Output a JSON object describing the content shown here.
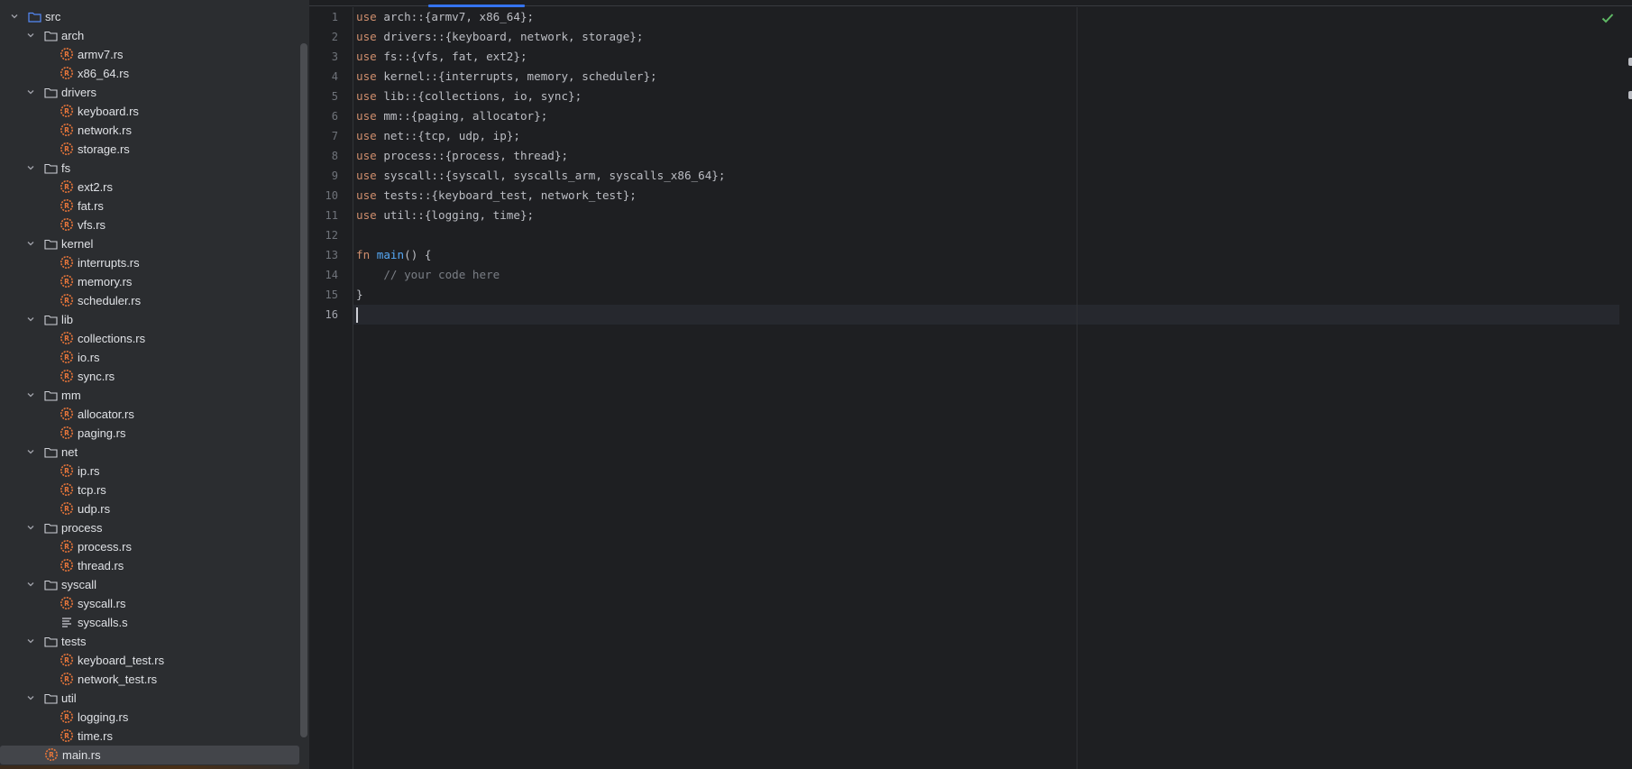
{
  "project_tree": {
    "items": [
      {
        "label": "src",
        "kind": "folder",
        "depth": 0,
        "expanded": true,
        "selected": false
      },
      {
        "label": "arch",
        "kind": "folder",
        "depth": 1,
        "expanded": true,
        "selected": false
      },
      {
        "label": "armv7.rs",
        "kind": "rust-file",
        "depth": 2,
        "selected": false
      },
      {
        "label": "x86_64.rs",
        "kind": "rust-file",
        "depth": 2,
        "selected": false
      },
      {
        "label": "drivers",
        "kind": "folder",
        "depth": 1,
        "expanded": true,
        "selected": false
      },
      {
        "label": "keyboard.rs",
        "kind": "rust-file",
        "depth": 2,
        "selected": false
      },
      {
        "label": "network.rs",
        "kind": "rust-file",
        "depth": 2,
        "selected": false
      },
      {
        "label": "storage.rs",
        "kind": "rust-file",
        "depth": 2,
        "selected": false
      },
      {
        "label": "fs",
        "kind": "folder",
        "depth": 1,
        "expanded": true,
        "selected": false
      },
      {
        "label": "ext2.rs",
        "kind": "rust-file",
        "depth": 2,
        "selected": false
      },
      {
        "label": "fat.rs",
        "kind": "rust-file",
        "depth": 2,
        "selected": false
      },
      {
        "label": "vfs.rs",
        "kind": "rust-file",
        "depth": 2,
        "selected": false
      },
      {
        "label": "kernel",
        "kind": "folder",
        "depth": 1,
        "expanded": true,
        "selected": false
      },
      {
        "label": "interrupts.rs",
        "kind": "rust-file",
        "depth": 2,
        "selected": false
      },
      {
        "label": "memory.rs",
        "kind": "rust-file",
        "depth": 2,
        "selected": false
      },
      {
        "label": "scheduler.rs",
        "kind": "rust-file",
        "depth": 2,
        "selected": false
      },
      {
        "label": "lib",
        "kind": "folder",
        "depth": 1,
        "expanded": true,
        "selected": false
      },
      {
        "label": "collections.rs",
        "kind": "rust-file",
        "depth": 2,
        "selected": false
      },
      {
        "label": "io.rs",
        "kind": "rust-file",
        "depth": 2,
        "selected": false
      },
      {
        "label": "sync.rs",
        "kind": "rust-file",
        "depth": 2,
        "selected": false
      },
      {
        "label": "mm",
        "kind": "folder",
        "depth": 1,
        "expanded": true,
        "selected": false
      },
      {
        "label": "allocator.rs",
        "kind": "rust-file",
        "depth": 2,
        "selected": false
      },
      {
        "label": "paging.rs",
        "kind": "rust-file",
        "depth": 2,
        "selected": false
      },
      {
        "label": "net",
        "kind": "folder",
        "depth": 1,
        "expanded": true,
        "selected": false
      },
      {
        "label": "ip.rs",
        "kind": "rust-file",
        "depth": 2,
        "selected": false
      },
      {
        "label": "tcp.rs",
        "kind": "rust-file",
        "depth": 2,
        "selected": false
      },
      {
        "label": "udp.rs",
        "kind": "rust-file",
        "depth": 2,
        "selected": false
      },
      {
        "label": "process",
        "kind": "folder",
        "depth": 1,
        "expanded": true,
        "selected": false
      },
      {
        "label": "process.rs",
        "kind": "rust-file",
        "depth": 2,
        "selected": false
      },
      {
        "label": "thread.rs",
        "kind": "rust-file",
        "depth": 2,
        "selected": false
      },
      {
        "label": "syscall",
        "kind": "folder",
        "depth": 1,
        "expanded": true,
        "selected": false
      },
      {
        "label": "syscall.rs",
        "kind": "rust-file",
        "depth": 2,
        "selected": false
      },
      {
        "label": "syscalls.s",
        "kind": "text-file",
        "depth": 2,
        "selected": false
      },
      {
        "label": "tests",
        "kind": "folder",
        "depth": 1,
        "expanded": true,
        "selected": false
      },
      {
        "label": "keyboard_test.rs",
        "kind": "rust-file",
        "depth": 2,
        "selected": false
      },
      {
        "label": "network_test.rs",
        "kind": "rust-file",
        "depth": 2,
        "selected": false
      },
      {
        "label": "util",
        "kind": "folder",
        "depth": 1,
        "expanded": true,
        "selected": false
      },
      {
        "label": "logging.rs",
        "kind": "rust-file",
        "depth": 2,
        "selected": false
      },
      {
        "label": "time.rs",
        "kind": "rust-file",
        "depth": 2,
        "selected": false
      },
      {
        "label": "main.rs",
        "kind": "rust-file",
        "depth": 1,
        "selected": true
      }
    ]
  },
  "editor": {
    "current_line": 16,
    "lines": [
      {
        "number": "1",
        "tokens": [
          {
            "t": "use",
            "c": "kw"
          },
          {
            "t": " arch::{armv7, x86_64};",
            "c": "txt"
          }
        ]
      },
      {
        "number": "2",
        "tokens": [
          {
            "t": "use",
            "c": "kw"
          },
          {
            "t": " drivers::{keyboard, network, storage};",
            "c": "txt"
          }
        ]
      },
      {
        "number": "3",
        "tokens": [
          {
            "t": "use",
            "c": "kw"
          },
          {
            "t": " fs::{vfs, fat, ext2};",
            "c": "txt"
          }
        ]
      },
      {
        "number": "4",
        "tokens": [
          {
            "t": "use",
            "c": "kw"
          },
          {
            "t": " kernel::{interrupts, memory, scheduler};",
            "c": "txt"
          }
        ]
      },
      {
        "number": "5",
        "tokens": [
          {
            "t": "use",
            "c": "kw"
          },
          {
            "t": " lib::{collections, io, sync};",
            "c": "txt"
          }
        ]
      },
      {
        "number": "6",
        "tokens": [
          {
            "t": "use",
            "c": "kw"
          },
          {
            "t": " mm::{paging, allocator};",
            "c": "txt"
          }
        ]
      },
      {
        "number": "7",
        "tokens": [
          {
            "t": "use",
            "c": "kw"
          },
          {
            "t": " net::{tcp, udp, ip};",
            "c": "txt"
          }
        ]
      },
      {
        "number": "8",
        "tokens": [
          {
            "t": "use",
            "c": "kw"
          },
          {
            "t": " process::{process, thread};",
            "c": "txt"
          }
        ]
      },
      {
        "number": "9",
        "tokens": [
          {
            "t": "use",
            "c": "kw"
          },
          {
            "t": " syscall::{syscall, syscalls_arm, syscalls_x86_64};",
            "c": "txt"
          }
        ]
      },
      {
        "number": "10",
        "tokens": [
          {
            "t": "use",
            "c": "kw"
          },
          {
            "t": " tests::{keyboard_test, network_test};",
            "c": "txt"
          }
        ]
      },
      {
        "number": "11",
        "tokens": [
          {
            "t": "use",
            "c": "kw"
          },
          {
            "t": " util::{logging, time};",
            "c": "txt"
          }
        ]
      },
      {
        "number": "12",
        "tokens": []
      },
      {
        "number": "13",
        "tokens": [
          {
            "t": "fn",
            "c": "kw"
          },
          {
            "t": " ",
            "c": "txt"
          },
          {
            "t": "main",
            "c": "fn"
          },
          {
            "t": "() {",
            "c": "txt"
          }
        ]
      },
      {
        "number": "14",
        "tokens": [
          {
            "t": "    ",
            "c": "txt"
          },
          {
            "t": "// your code here",
            "c": "cm"
          }
        ]
      },
      {
        "number": "15",
        "tokens": [
          {
            "t": "}",
            "c": "txt"
          }
        ]
      },
      {
        "number": "16",
        "tokens": []
      }
    ]
  },
  "icons": {
    "folder": "folder-icon",
    "rust_file": "rust-file-icon",
    "text_file": "text-file-icon",
    "chevron": "chevron-down-icon",
    "inspection": "checkmark-icon"
  },
  "colors": {
    "folder_blue": "#548af7",
    "rust_orange": "#e8763a",
    "check_green": "#5fb865",
    "accent_blue": "#3574f0"
  }
}
